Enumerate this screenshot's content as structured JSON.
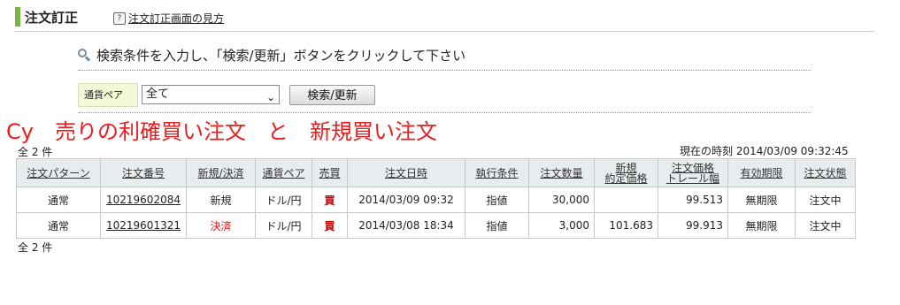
{
  "header": {
    "title": "注文訂正",
    "help_link": "注文訂正画面の見方"
  },
  "instruction": "検索条件を入力し、「検索/更新」ボタンをクリックして下さい",
  "search": {
    "currency_label": "通貨ペア",
    "currency_selected": "全て",
    "button": "検索/更新"
  },
  "annotation": "Cy　売りの利確買い注文　と　新規買い注文",
  "summary": {
    "count_top": "全 2 件",
    "count_bottom": "全 2 件",
    "current_time": "現在の時刻 2014/03/09 09:32:45"
  },
  "table": {
    "headers": {
      "pattern": "注文パターン",
      "order_no": "注文番号",
      "type": "新規/決済",
      "pair": "通貨ペア",
      "side": "売買",
      "datetime": "注文日時",
      "condition": "執行条件",
      "qty": "注文数量",
      "entry_price_1": "新規",
      "entry_price_2": "約定価格",
      "order_price_1": "注文価格",
      "order_price_2": "トレール幅",
      "validity": "有効期限",
      "status": "注文状態"
    },
    "rows": [
      {
        "pattern": "通常",
        "order_no": "10219602084",
        "type": "新規",
        "pair": "ドル/円",
        "side": "買",
        "datetime": "2014/03/09 09:32",
        "condition": "指値",
        "qty": "30,000",
        "entry_price": "",
        "order_price": "99.513",
        "validity": "無期限",
        "status": "注文中"
      },
      {
        "pattern": "通常",
        "order_no": "10219601321",
        "type": "決済",
        "pair": "ドル/円",
        "side": "買",
        "datetime": "2014/03/08 18:34",
        "condition": "指値",
        "qty": "3,000",
        "entry_price": "101.683",
        "order_price": "99.913",
        "validity": "無期限",
        "status": "注文中"
      }
    ]
  },
  "colors": {
    "accent_bar": "#7cb342",
    "annotation_red": "#ee1c1c",
    "header_bg": "#e7ecef",
    "search_label_bg": "#f3f8d8"
  }
}
